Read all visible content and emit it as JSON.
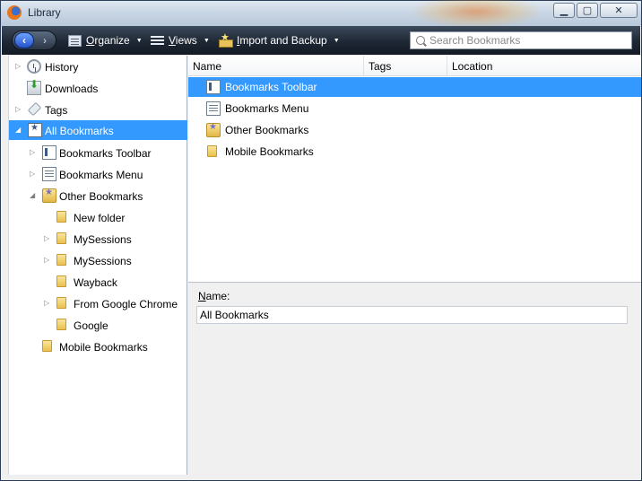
{
  "window": {
    "title": "Library",
    "controls": [
      "minimize",
      "maximize",
      "close"
    ]
  },
  "toolbar": {
    "back_icon": "back-arrow-icon",
    "forward_icon": "forward-arrow-icon",
    "organize_label": "Organize",
    "views_label": "Views",
    "import_label": "Import and Backup",
    "search_placeholder": "Search Bookmarks"
  },
  "sidebar": {
    "items": [
      {
        "label": "History",
        "icon": "history-icon",
        "expandable": true,
        "expanded": false,
        "selected": false
      },
      {
        "label": "Downloads",
        "icon": "downloads-icon",
        "expandable": false,
        "expanded": false,
        "selected": false
      },
      {
        "label": "Tags",
        "icon": "tags-icon",
        "expandable": true,
        "expanded": false,
        "selected": false
      },
      {
        "label": "All Bookmarks",
        "icon": "all-bookmarks-icon",
        "expandable": true,
        "expanded": true,
        "selected": true
      },
      {
        "label": "Bookmarks Toolbar",
        "icon": "bookmarks-toolbar-icon",
        "expandable": true,
        "expanded": false,
        "selected": false
      },
      {
        "label": "Bookmarks Menu",
        "icon": "bookmarks-menu-icon",
        "expandable": true,
        "expanded": false,
        "selected": false
      },
      {
        "label": "Other Bookmarks",
        "icon": "other-bookmarks-icon",
        "expandable": true,
        "expanded": true,
        "selected": false
      },
      {
        "label": "New folder",
        "icon": "folder-icon",
        "expandable": false,
        "expanded": false,
        "selected": false
      },
      {
        "label": "MySessions",
        "icon": "folder-icon",
        "expandable": true,
        "expanded": false,
        "selected": false
      },
      {
        "label": "MySessions",
        "icon": "folder-icon",
        "expandable": true,
        "expanded": false,
        "selected": false
      },
      {
        "label": "Wayback",
        "icon": "folder-icon",
        "expandable": false,
        "expanded": false,
        "selected": false
      },
      {
        "label": "From Google Chrome",
        "icon": "folder-icon",
        "expandable": true,
        "expanded": false,
        "selected": false
      },
      {
        "label": "Google",
        "icon": "folder-icon",
        "expandable": false,
        "expanded": false,
        "selected": false
      },
      {
        "label": "Mobile Bookmarks",
        "icon": "folder-icon",
        "expandable": false,
        "expanded": false,
        "selected": false
      }
    ]
  },
  "list": {
    "columns": [
      "Name",
      "Tags",
      "Location"
    ],
    "rows": [
      {
        "name": "Bookmarks Toolbar",
        "icon": "bookmarks-toolbar-icon",
        "tags": "",
        "location": "",
        "selected": true
      },
      {
        "name": "Bookmarks Menu",
        "icon": "bookmarks-menu-icon",
        "tags": "",
        "location": "",
        "selected": false
      },
      {
        "name": "Other Bookmarks",
        "icon": "other-bookmarks-icon",
        "tags": "",
        "location": "",
        "selected": false
      },
      {
        "name": "Mobile Bookmarks",
        "icon": "folder-icon",
        "tags": "",
        "location": "",
        "selected": false
      }
    ]
  },
  "details": {
    "name_label": "Name:",
    "name_value": "All Bookmarks"
  },
  "colors": {
    "selection": "#3399ff",
    "toolbar_dark": "#1e2734",
    "back_button": "#2453c8"
  }
}
